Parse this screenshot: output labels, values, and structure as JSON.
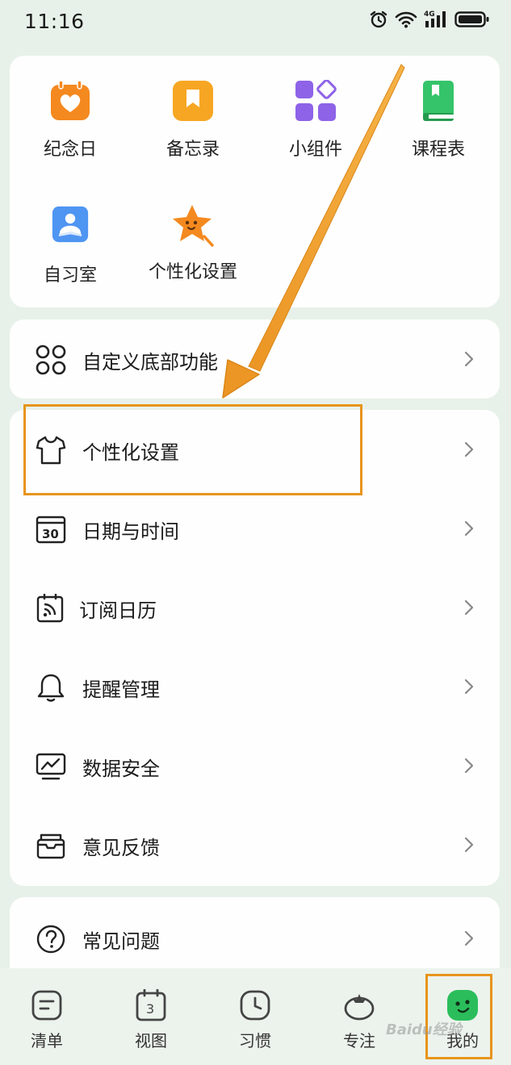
{
  "status_bar": {
    "time": "11:16",
    "network": "4G"
  },
  "tools": [
    {
      "label": "纪念日",
      "icon": "anniversary-heart-icon",
      "color": "#f4891f"
    },
    {
      "label": "备忘录",
      "icon": "memo-bookmark-icon",
      "color": "#f7a623"
    },
    {
      "label": "小组件",
      "icon": "widgets-icon",
      "color": "#8e63e8"
    },
    {
      "label": "课程表",
      "icon": "course-book-icon",
      "color": "#35c46a"
    },
    {
      "label": "自习室",
      "icon": "study-room-icon",
      "color": "#4f95f2"
    },
    {
      "label": "个性化设置",
      "icon": "star-mascot-icon",
      "color": "#f4891f"
    }
  ],
  "custom_row": {
    "label": "自定义底部功能",
    "icon": "grid-circles-icon"
  },
  "settings_rows": [
    {
      "label": "个性化设置",
      "icon": "tshirt-icon"
    },
    {
      "label": "日期与时间",
      "icon": "calendar-30-icon"
    },
    {
      "label": "订阅日历",
      "icon": "subscribe-calendar-icon"
    },
    {
      "label": "提醒管理",
      "icon": "bell-icon"
    },
    {
      "label": "数据安全",
      "icon": "monitor-chart-icon"
    },
    {
      "label": "意见反馈",
      "icon": "feedback-inbox-icon"
    }
  ],
  "faq_row": {
    "label": "常见问题",
    "icon": "question-circle-icon"
  },
  "tabbar": [
    {
      "label": "清单",
      "icon": "list-icon"
    },
    {
      "label": "视图",
      "icon": "calendar-view-icon",
      "badge": "3"
    },
    {
      "label": "习惯",
      "icon": "clock-icon"
    },
    {
      "label": "专注",
      "icon": "tomato-icon"
    },
    {
      "label": "我的",
      "icon": "smile-avatar-icon",
      "active": true
    }
  ],
  "colors": {
    "accent": "#2bbd5b",
    "annotation": "#e8941c",
    "background": "#e8f1e9"
  },
  "watermark": "Baidu经验"
}
